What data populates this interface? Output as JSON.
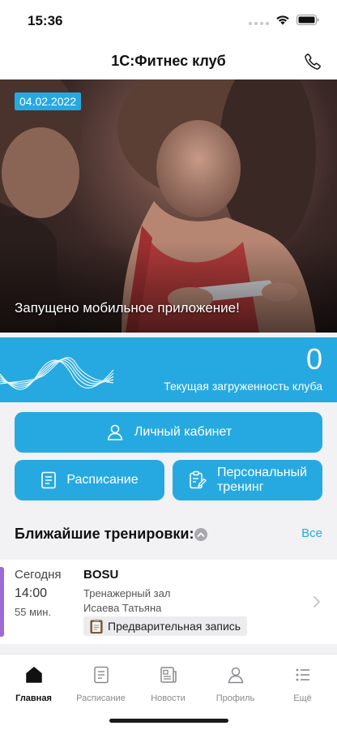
{
  "status_bar": {
    "time": "15:36"
  },
  "header": {
    "title": "1С:Фитнес клуб"
  },
  "hero": {
    "date": "04.02.2022",
    "caption": "Запущено мобильное приложение!"
  },
  "club_load": {
    "value": "0",
    "label": "Текущая загруженность клуба"
  },
  "actions": {
    "cabinet": "Личный кабинет",
    "schedule": "Расписание",
    "personal_line1": "Персональный",
    "personal_line2": "тренинг"
  },
  "upcoming": {
    "title": "Ближайшие тренировки:",
    "all_link": "Все",
    "sessions": [
      {
        "day": "Сегодня",
        "time": "14:00",
        "duration": "55 мин.",
        "name": "BOSU",
        "hall": "Тренажерный зал",
        "trainer": "Исаева Татьяна",
        "tag": "Предварительная запись",
        "accent_color": "#9b6bd6"
      }
    ]
  },
  "tab_bar": {
    "tabs": [
      {
        "label": "Главная",
        "icon": "home-icon",
        "active": true
      },
      {
        "label": "Расписание",
        "icon": "schedule-icon",
        "active": false
      },
      {
        "label": "Новости",
        "icon": "news-icon",
        "active": false
      },
      {
        "label": "Профиль",
        "icon": "profile-icon",
        "active": false
      },
      {
        "label": "Ещё",
        "icon": "more-icon",
        "active": false
      }
    ]
  },
  "colors": {
    "accent": "#26a9e0",
    "session_accent": "#9b6bd6"
  }
}
